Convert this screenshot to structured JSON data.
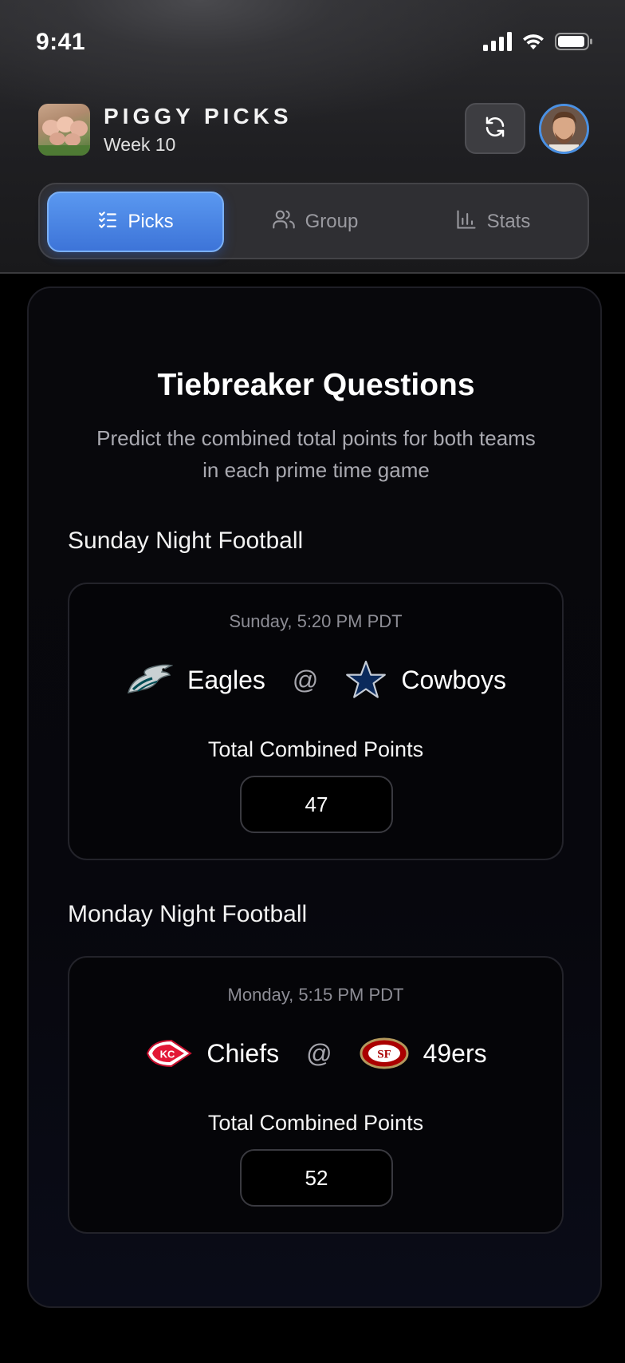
{
  "status_bar": {
    "time": "9:41"
  },
  "header": {
    "title": "PIGGY PICKS",
    "subtitle": "Week 10"
  },
  "tabs": [
    {
      "label": "Picks",
      "icon": "list-check-icon",
      "active": true
    },
    {
      "label": "Group",
      "icon": "users-icon",
      "active": false
    },
    {
      "label": "Stats",
      "icon": "bar-chart-icon",
      "active": false
    }
  ],
  "tiebreaker": {
    "title": "Tiebreaker Questions",
    "description": "Predict the combined total points for both teams in each prime time game",
    "games": [
      {
        "section": "Sunday Night Football",
        "time": "Sunday, 5:20 PM PDT",
        "away_team": "Eagles",
        "home_team": "Cowboys",
        "at": "@",
        "points_label": "Total Combined Points",
        "points_value": "47"
      },
      {
        "section": "Monday Night Football",
        "time": "Monday, 5:15 PM PDT",
        "away_team": "Chiefs",
        "home_team": "49ers",
        "at": "@",
        "points_label": "Total Combined Points",
        "points_value": "52"
      }
    ]
  },
  "colors": {
    "accent": "#4a86e8",
    "background": "#000000",
    "card": "#08080c"
  }
}
